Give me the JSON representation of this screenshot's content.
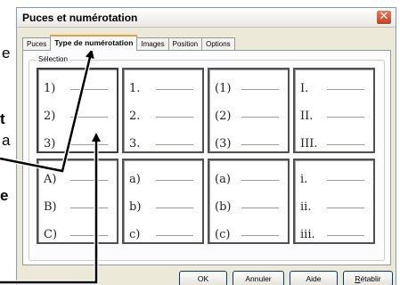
{
  "background_text": [
    "e",
    "t",
    "a",
    "e"
  ],
  "dialog": {
    "title": "Puces et numérotation",
    "tabs": [
      "Puces",
      "Type de numérotation",
      "Images",
      "Position",
      "Options"
    ],
    "active_tab": 1,
    "fieldset_label": "Sélection",
    "cells": [
      [
        "1)",
        "2)",
        "3)"
      ],
      [
        "1.",
        "2.",
        "3."
      ],
      [
        "(1)",
        "(2)",
        "(3)"
      ],
      [
        "I.",
        "II.",
        "III."
      ],
      [
        "A)",
        "B)",
        "C)"
      ],
      [
        "a)",
        "b)",
        "c)"
      ],
      [
        "(a)",
        "(b)",
        "(c)"
      ],
      [
        "i.",
        "ii.",
        "iii."
      ]
    ],
    "buttons": {
      "ok": "OK",
      "cancel": "Annuler",
      "help": "Aide",
      "reset": "Rétablir"
    }
  },
  "colors": {
    "dialog_bg": "#ece9d8",
    "tab_accent": "#e6a03c",
    "close_red": "#c24327"
  }
}
